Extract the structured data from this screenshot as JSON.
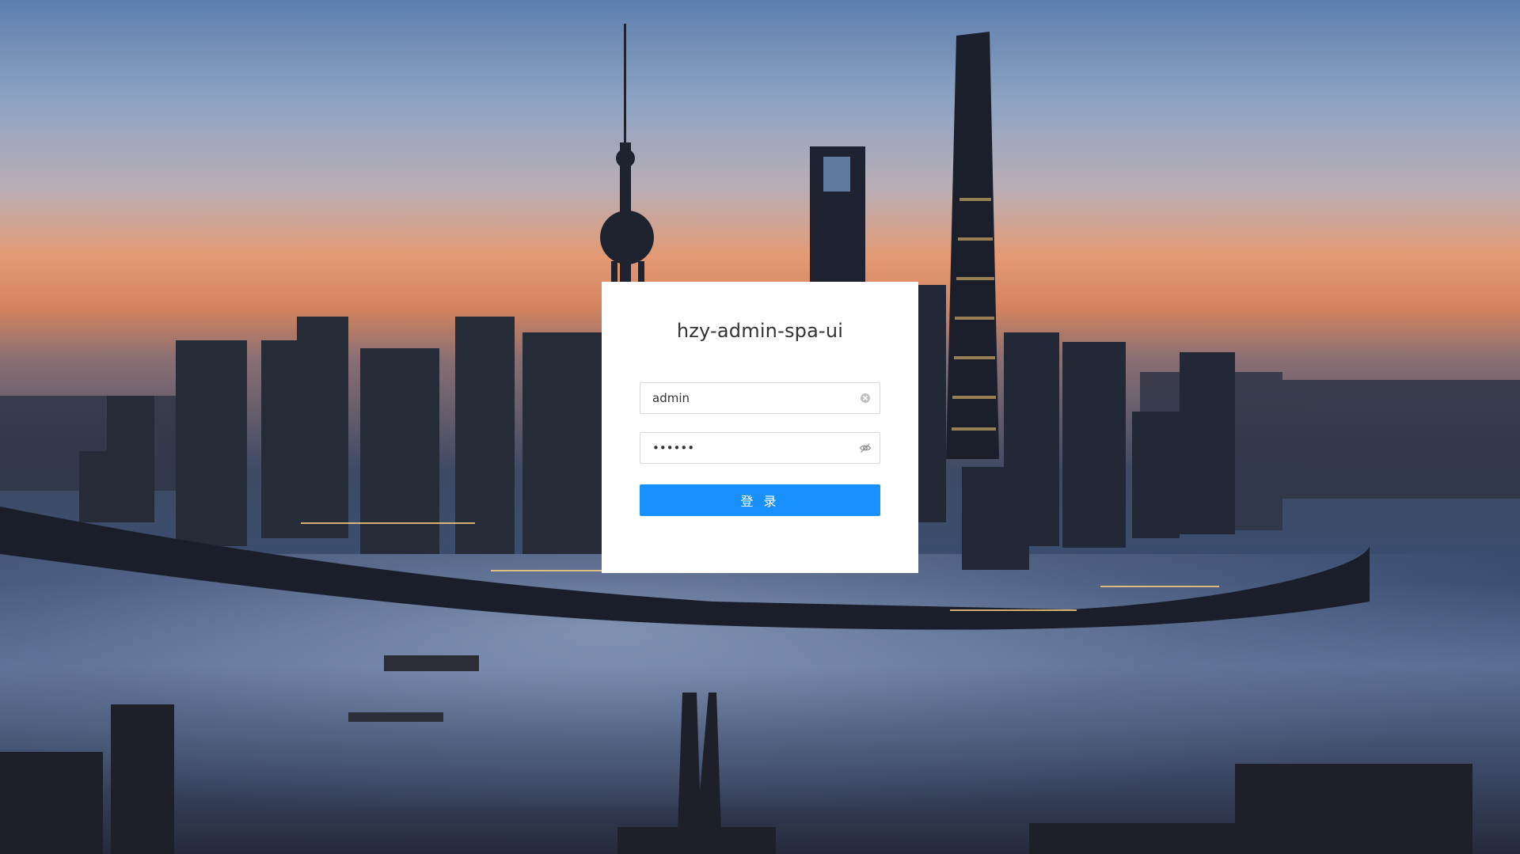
{
  "login": {
    "title": "hzy-admin-spa-ui",
    "username_value": "admin",
    "password_value": "••••••",
    "submit_label": "登 录"
  },
  "icons": {
    "clear": "clear-circle-icon",
    "password_toggle": "eye-invisible-icon"
  },
  "colors": {
    "primary": "#1890ff",
    "card_bg": "#ffffff",
    "title": "#333333"
  }
}
